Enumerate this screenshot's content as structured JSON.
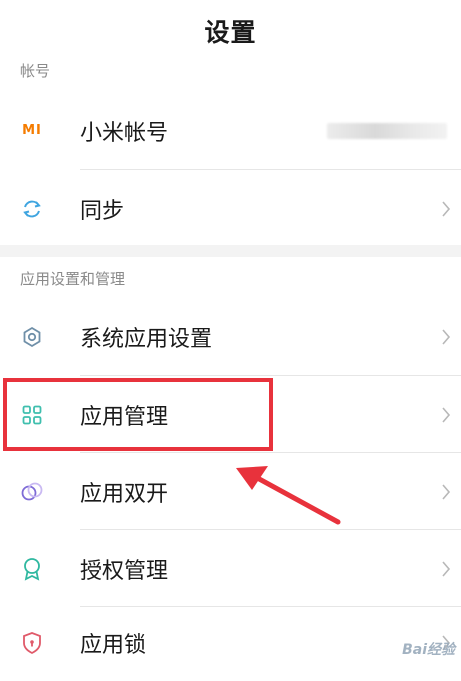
{
  "header": {
    "title": "设置"
  },
  "sections": {
    "account_label": "帐号",
    "apps_label": "应用设置和管理"
  },
  "rows": {
    "mi_account": {
      "label": "小米帐号",
      "icon": "mi-logo-icon"
    },
    "sync": {
      "label": "同步",
      "icon": "sync-icon"
    },
    "system_apps": {
      "label": "系统应用设置",
      "icon": "gear-icon"
    },
    "app_manage": {
      "label": "应用管理",
      "icon": "grid-icon"
    },
    "dual_apps": {
      "label": "应用双开",
      "icon": "dual-circle-icon"
    },
    "permissions": {
      "label": "授权管理",
      "icon": "badge-icon"
    },
    "app_lock": {
      "label": "应用锁",
      "icon": "shield-icon"
    }
  },
  "mi_logo_text": "MI",
  "annotation": {
    "highlight_color": "#e8323c"
  },
  "colors": {
    "accent": "#3fbfae",
    "mi_orange": "#f57c00"
  },
  "watermark": "Bai经验"
}
